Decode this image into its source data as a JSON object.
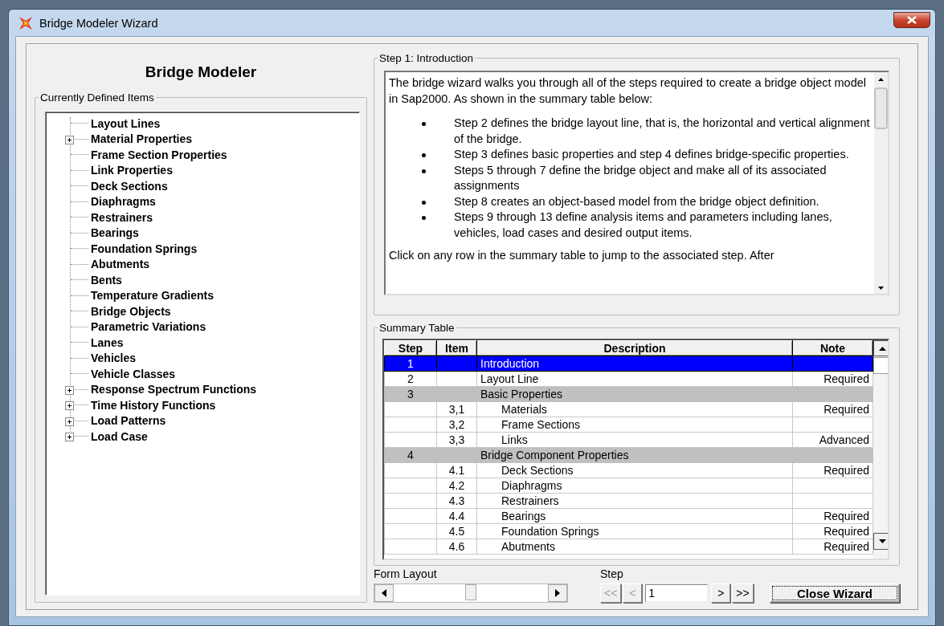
{
  "window": {
    "title": "Bridge Modeler Wizard"
  },
  "heading": "Bridge Modeler",
  "defined_items": {
    "label": "Currently Defined Items",
    "items": [
      {
        "label": "Layout Lines",
        "kind": "leaf"
      },
      {
        "label": "Material Properties",
        "kind": "group",
        "expanded": false
      },
      {
        "label": "Frame Section Properties",
        "kind": "leaf"
      },
      {
        "label": "Link Properties",
        "kind": "leaf"
      },
      {
        "label": "Deck Sections",
        "kind": "leaf"
      },
      {
        "label": "Diaphragms",
        "kind": "leaf"
      },
      {
        "label": "Restrainers",
        "kind": "leaf"
      },
      {
        "label": "Bearings",
        "kind": "leaf"
      },
      {
        "label": "Foundation Springs",
        "kind": "leaf"
      },
      {
        "label": "Abutments",
        "kind": "leaf"
      },
      {
        "label": "Bents",
        "kind": "leaf"
      },
      {
        "label": "Temperature Gradients",
        "kind": "leaf"
      },
      {
        "label": "Bridge Objects",
        "kind": "leaf"
      },
      {
        "label": "Parametric Variations",
        "kind": "leaf"
      },
      {
        "label": "Lanes",
        "kind": "leaf"
      },
      {
        "label": "Vehicles",
        "kind": "leaf"
      },
      {
        "label": "Vehicle Classes",
        "kind": "leaf"
      },
      {
        "label": "Response Spectrum Functions",
        "kind": "group",
        "expanded": false
      },
      {
        "label": "Time History Functions",
        "kind": "group",
        "expanded": false
      },
      {
        "label": "Load Patterns",
        "kind": "group",
        "expanded": false
      },
      {
        "label": "Load Case",
        "kind": "group",
        "expanded": false
      }
    ]
  },
  "introduction": {
    "label": "Step 1:  Introduction",
    "intro_text": "The bridge wizard walks you through all of the steps required to create a bridge object model in Sap2000. As shown in the summary table below:",
    "bullets": [
      "Step 2 defines the bridge layout line, that is, the horizontal and vertical alignment of the bridge.",
      "Step 3 defines basic properties and step 4 defines bridge-specific properties.",
      "Steps 5 through 7 define the bridge object and make all of its associated assignments",
      "Step 8 creates an object-based model from the bridge object definition.",
      "Steps 9 through 13 define analysis items and parameters including lanes, vehicles, load cases and desired output items."
    ],
    "closing_text": "Click on any row in the summary table to jump to the associated step. After"
  },
  "summary_table": {
    "label": "Summary Table",
    "columns": [
      "Step",
      "Item",
      "Description",
      "Note"
    ],
    "rows": [
      {
        "kind": "step",
        "step": "1",
        "description": "Introduction",
        "selected": true
      },
      {
        "kind": "step",
        "step": "2",
        "description": "Layout Line",
        "note": "Required",
        "selected": false
      },
      {
        "kind": "section",
        "step": "3",
        "description": "Basic Properties",
        "selected": false
      },
      {
        "kind": "sub",
        "item": "3,1",
        "description": "Materials",
        "note": "Required",
        "selected": false
      },
      {
        "kind": "sub",
        "item": "3,2",
        "description": "Frame Sections",
        "selected": false
      },
      {
        "kind": "sub",
        "item": "3,3",
        "description": "Links",
        "note": "Advanced",
        "selected": false
      },
      {
        "kind": "section",
        "step": "4",
        "description": "Bridge Component Properties",
        "selected": false
      },
      {
        "kind": "sub",
        "item": "4.1",
        "description": "Deck Sections",
        "note": "Required",
        "selected": false
      },
      {
        "kind": "sub",
        "item": "4.2",
        "description": "Diaphragms",
        "selected": false
      },
      {
        "kind": "sub",
        "item": "4.3",
        "description": "Restrainers",
        "selected": false
      },
      {
        "kind": "sub",
        "item": "4.4",
        "description": "Bearings",
        "note": "Required",
        "selected": false
      },
      {
        "kind": "sub",
        "item": "4.5",
        "description": "Foundation Springs",
        "note": "Required",
        "selected": false
      },
      {
        "kind": "sub",
        "item": "4.6",
        "description": "Abutments",
        "note": "Required",
        "selected": false
      }
    ]
  },
  "form_layout": {
    "label": "Form Layout",
    "level": 0.5
  },
  "step_nav": {
    "label": "Step",
    "value": "1",
    "buttons": [
      {
        "label": "<<",
        "disabled": true
      },
      {
        "label": "<",
        "disabled": true
      },
      {
        "label": ">",
        "disabled": false
      },
      {
        "label": ">>",
        "disabled": false
      }
    ]
  },
  "close_button": "Close Wizard"
}
